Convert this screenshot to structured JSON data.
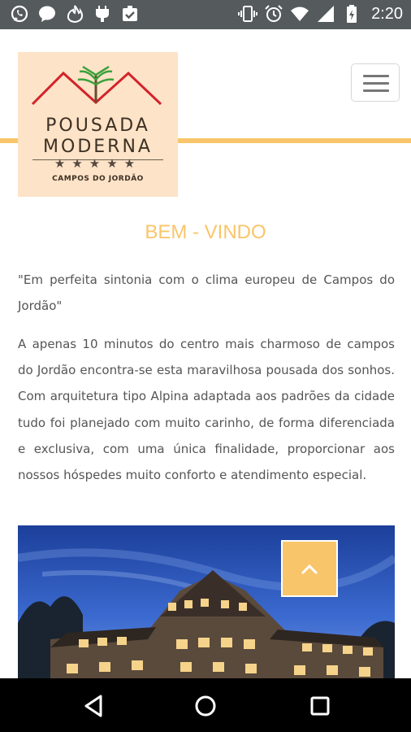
{
  "status_bar": {
    "time": "2:20",
    "left_icons": [
      "whatsapp-icon",
      "messenger-icon",
      "tinder-icon",
      "android-debug-icon",
      "clipboard-check-icon"
    ],
    "right_icons": [
      "vibrate-icon",
      "alarm-icon",
      "wifi-icon",
      "signal-icon",
      "battery-icon"
    ]
  },
  "header": {
    "logo": {
      "line1": "POUSADA",
      "line2": "MODERNA",
      "stars": "★★★★★",
      "location": "CAMPOS DO JORDÃO"
    },
    "menu_icon": "hamburger-menu-icon"
  },
  "content": {
    "title": "BEM - VINDO",
    "quote": "\"Em perfeita sintonia com o clima europeu de Campos do Jordão\"",
    "paragraph": "A apenas 10 minutos do centro mais charmoso de campos do Jordão encontra-se esta maravilhosa pousada dos sonhos. Com arquitetura tipo Alpina adaptada aos padrões da cidade tudo foi planejado com muito carinho, de forma diferenciada e exclusiva, com uma única finalidade, proporcionar aos nossos hóspedes muito conforto e atendimento especial.",
    "scroll_top_icon": "chevron-up-icon"
  },
  "navigation_bar": {
    "back_icon": "back-triangle-icon",
    "home_icon": "home-circle-icon",
    "recents_icon": "recents-square-icon"
  },
  "colors": {
    "accent": "#f9c56a",
    "logo_bg": "#fde3c7",
    "status_bar": "#555a5c",
    "text": "#555555"
  }
}
